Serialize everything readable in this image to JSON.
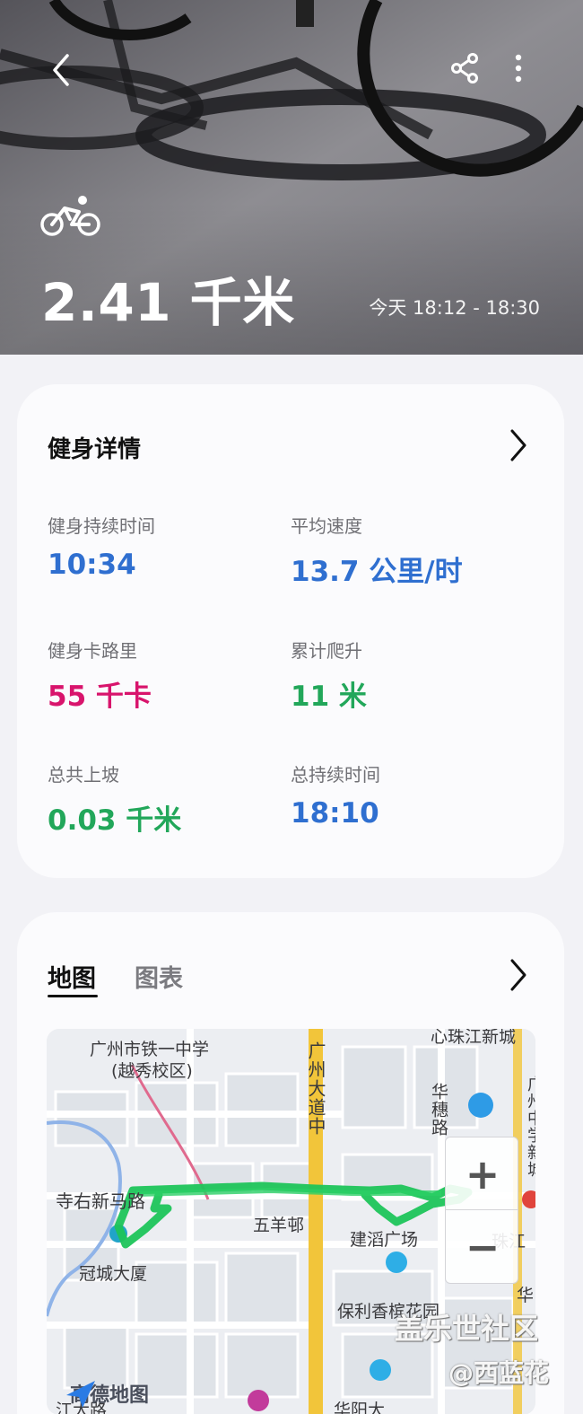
{
  "header": {
    "back_icon": "chevron-left-icon",
    "share_icon": "share-icon",
    "more_icon": "more-vertical-icon",
    "activity_icon": "bicycle-icon",
    "distance": "2.41 千米",
    "time_range": "今天 18:12 - 18:30"
  },
  "details": {
    "title": "健身详情",
    "metrics": [
      {
        "label": "健身持续时间",
        "value": "10:34",
        "color": "#2f6fd0"
      },
      {
        "label": "平均速度",
        "value": "13.7 公里/时",
        "color": "#2f6fd0"
      },
      {
        "label": "健身卡路里",
        "value": "55 千卡",
        "color": "#d8146c"
      },
      {
        "label": "累计爬升",
        "value": "11 米",
        "color": "#22a75a"
      },
      {
        "label": "总共上坡",
        "value": "0.03 千米",
        "color": "#22a75a"
      },
      {
        "label": "总持续时间",
        "value": "18:10",
        "color": "#2f6fd0"
      }
    ]
  },
  "map_section": {
    "tabs": [
      "地图",
      "图表"
    ],
    "active_tab": "地图",
    "map_labels": {
      "school_line1": "广州市铁一中学",
      "school_line2": "(越秀校区)",
      "top_right": "心珠江新城",
      "avenue": "广州大道中",
      "huasui_road": "华穗路",
      "right_edge": "广州中学新城",
      "road_left": "寺右新马路",
      "wuyang": "五羊邨",
      "jiandao": "建滔广场",
      "zhujiang": "珠江",
      "guancheng": "冠城大厦",
      "baoli": "保利香槟花园",
      "hua": "华",
      "bottom_left": "江大路",
      "bottom_mid": "华阳大",
      "provider": "高德地图"
    },
    "zoom_in": "+",
    "zoom_out": "−",
    "route_color": "#1ec45a"
  },
  "watermark": {
    "line1": "盖乐世社区",
    "line2": "@西蓝花"
  }
}
